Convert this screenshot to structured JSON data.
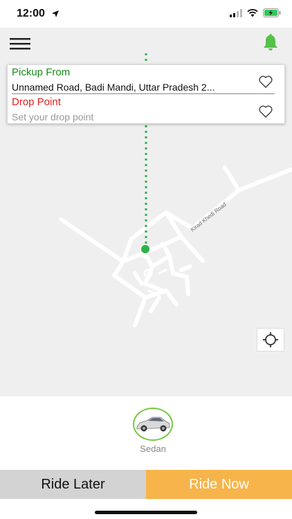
{
  "status_bar": {
    "time": "12:00",
    "icons": [
      "location-arrow-icon",
      "signal-icon",
      "wifi-icon",
      "battery-charging-icon"
    ]
  },
  "header": {
    "menu_icon": "hamburger-menu-icon",
    "notification_icon": "bell-icon"
  },
  "route": {
    "pickup_label": "Pickup From",
    "pickup_value": "Unnamed Road, Badi Mandi, Uttar Pradesh 2...",
    "drop_label": "Drop Point",
    "drop_placeholder": "Set your drop point",
    "favorite_icon": "heart-outline-icon"
  },
  "map": {
    "road_label": "Kirad Khedi Road",
    "locate_icon": "crosshair-locate-icon"
  },
  "vehicles": [
    {
      "label": "Sedan",
      "icon": "sedan-car-icon",
      "selected": true
    }
  ],
  "actions": {
    "ride_later": "Ride Later",
    "ride_now": "Ride Now"
  },
  "colors": {
    "pickup": "#1a8a1a",
    "drop": "#e02020",
    "accent_green": "#57c04a",
    "ride_now_bg": "#f7b44a",
    "ride_later_bg": "#d3d3d3"
  }
}
